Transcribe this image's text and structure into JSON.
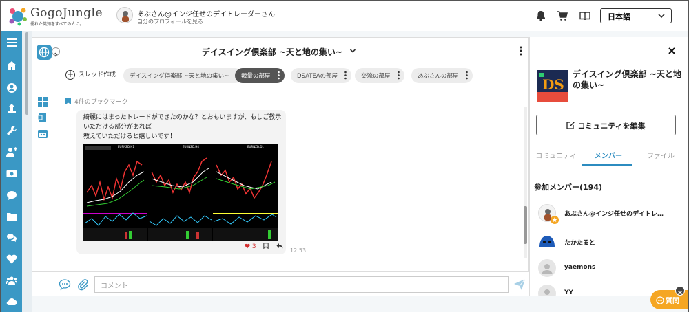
{
  "header": {
    "logo_name": "GogoJungle",
    "logo_tagline": "優れた英知をすべての人に。",
    "profile_name": "あぶさん@インジ任せのデイトレーダーさん",
    "profile_sub": "自分のプロフィールを見る",
    "icons": [
      "bell-icon",
      "cart-icon",
      "book-icon"
    ],
    "language": "日本語"
  },
  "sidebar": {
    "icons": [
      "menu-icon",
      "home-icon",
      "user-icon",
      "upload-icon",
      "wrench-icon",
      "add-user-icon",
      "money-icon",
      "chat-icon",
      "folder-icon",
      "comments-icon",
      "heart-icon",
      "group-icon",
      "cloud-icon"
    ]
  },
  "main": {
    "title": "デイスイング倶楽部 ~天と地の集い~",
    "new_thread": "スレッド作成",
    "tabs": [
      {
        "label": "デイスイング倶楽部 ~天と地の集い~",
        "active": false
      },
      {
        "label": "裁量の部屋",
        "active": true
      },
      {
        "label": "DSATEAの部屋",
        "active": false
      },
      {
        "label": "交流の部屋",
        "active": false
      },
      {
        "label": "あぶさんの部屋",
        "active": false
      }
    ],
    "bookmarks": "4件のブックマーク",
    "message": {
      "text_lines": [
        "綺麗にはまったトレードができたのかな？とおもいますが、もしご教示いただける部分があれば",
        "教えていただけると嬉しいです！"
      ],
      "chart_labels": [
        "EURNZD,H1",
        "EURNZD,H4",
        "EURNZD,D1"
      ],
      "likes": "3",
      "time": "12:53"
    },
    "composer_placeholder": "コメント"
  },
  "right": {
    "community_title": "デイスイング倶楽部 ~天と地の集い~",
    "edit_button": "コミュニティを編集",
    "tabs": [
      "コミュニティ",
      "メンバー",
      "ファイル"
    ],
    "active_tab": "メンバー",
    "members_title": "参加メンバー(194)",
    "members": [
      {
        "name": "あぶさん@インジ任せのデイトレ…"
      },
      {
        "name": "たかたると"
      },
      {
        "name": "yaemons"
      },
      {
        "name": "YY"
      }
    ]
  },
  "help_button": "質問",
  "colors": {
    "accent": "#3a98c5",
    "active_tab": "#555555",
    "like": "#d32f2f",
    "help": "#f5a623"
  }
}
